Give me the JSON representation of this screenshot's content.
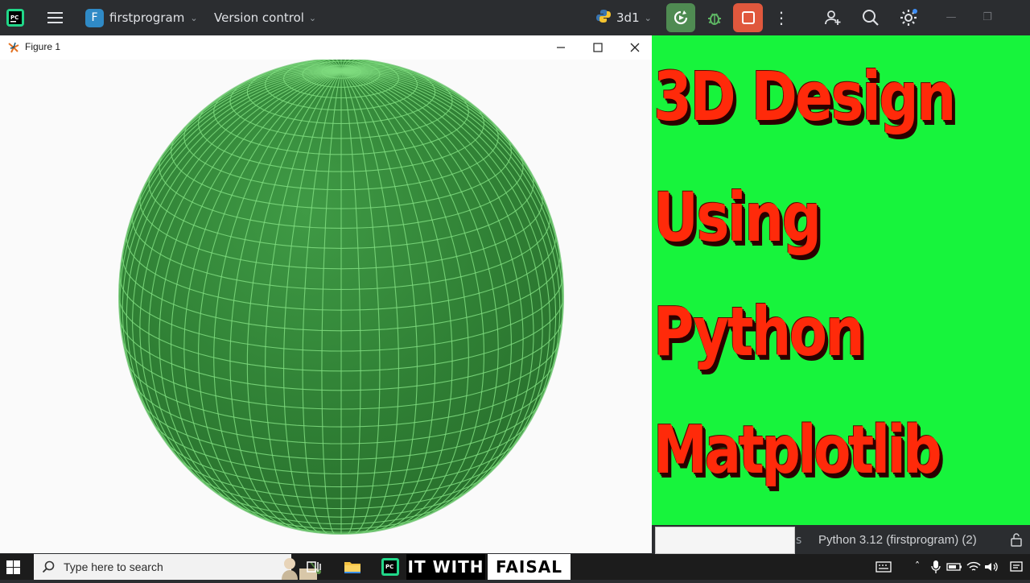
{
  "ide": {
    "project_initial": "F",
    "project_name": "firstprogram",
    "vcs_label": "Version control",
    "run_config": "3d1",
    "colors": {
      "toolbar_bg": "#2b2d30",
      "run_green": "#4f8b52",
      "stop_red": "#e0583d",
      "project_blue": "#2f8ac6"
    },
    "icons": [
      "pycharm-logo-icon",
      "hamburger-menu-icon",
      "python-icon",
      "run-icon",
      "debug-icon",
      "stop-icon",
      "more-icon",
      "add-user-icon",
      "search-icon",
      "settings-icon",
      "minimize-icon",
      "restore-icon"
    ]
  },
  "figure": {
    "title": "Figure 1",
    "plot": {
      "type": "3d-surface",
      "shape": "sphere",
      "style": "wireframe mesh",
      "color": "#2f7f34",
      "edge_color": "#7fdc7f"
    }
  },
  "promo": {
    "lines": [
      "3D Design",
      "Using",
      "Python",
      "Matplotlib"
    ],
    "colors": {
      "background": "#17f43c",
      "text": "#ff2a0a"
    }
  },
  "status": {
    "truncated": "s",
    "interpreter": "Python 3.12 (firstprogram) (2)"
  },
  "taskbar": {
    "search_placeholder": "Type here to search",
    "brand_part1": "IT WITH",
    "brand_part2": "FAISAL"
  }
}
